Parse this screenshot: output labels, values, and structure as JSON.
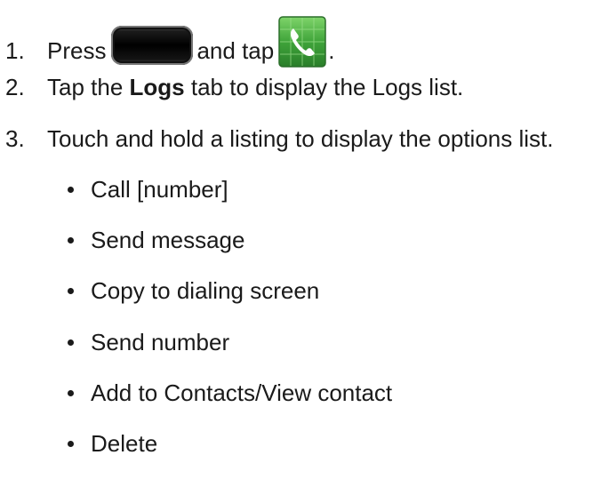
{
  "steps": [
    {
      "number": "1.",
      "text_before": "Press",
      "text_middle": "and tap",
      "text_after": "."
    },
    {
      "number": "2.",
      "text_before": "Tap the",
      "bold": "Logs",
      "text_after": "tab to display the Logs list."
    },
    {
      "number": "3.",
      "text": "Touch and hold a listing to display the options list."
    }
  ],
  "options": [
    "Call [number]",
    "Send message",
    "Copy to dialing screen",
    "Send number",
    "Add to Contacts/View contact",
    "Delete"
  ],
  "icons": {
    "home_key": "home-key-icon",
    "phone_app": "phone-app-icon",
    "phone_app_color": "#3fa43a"
  }
}
